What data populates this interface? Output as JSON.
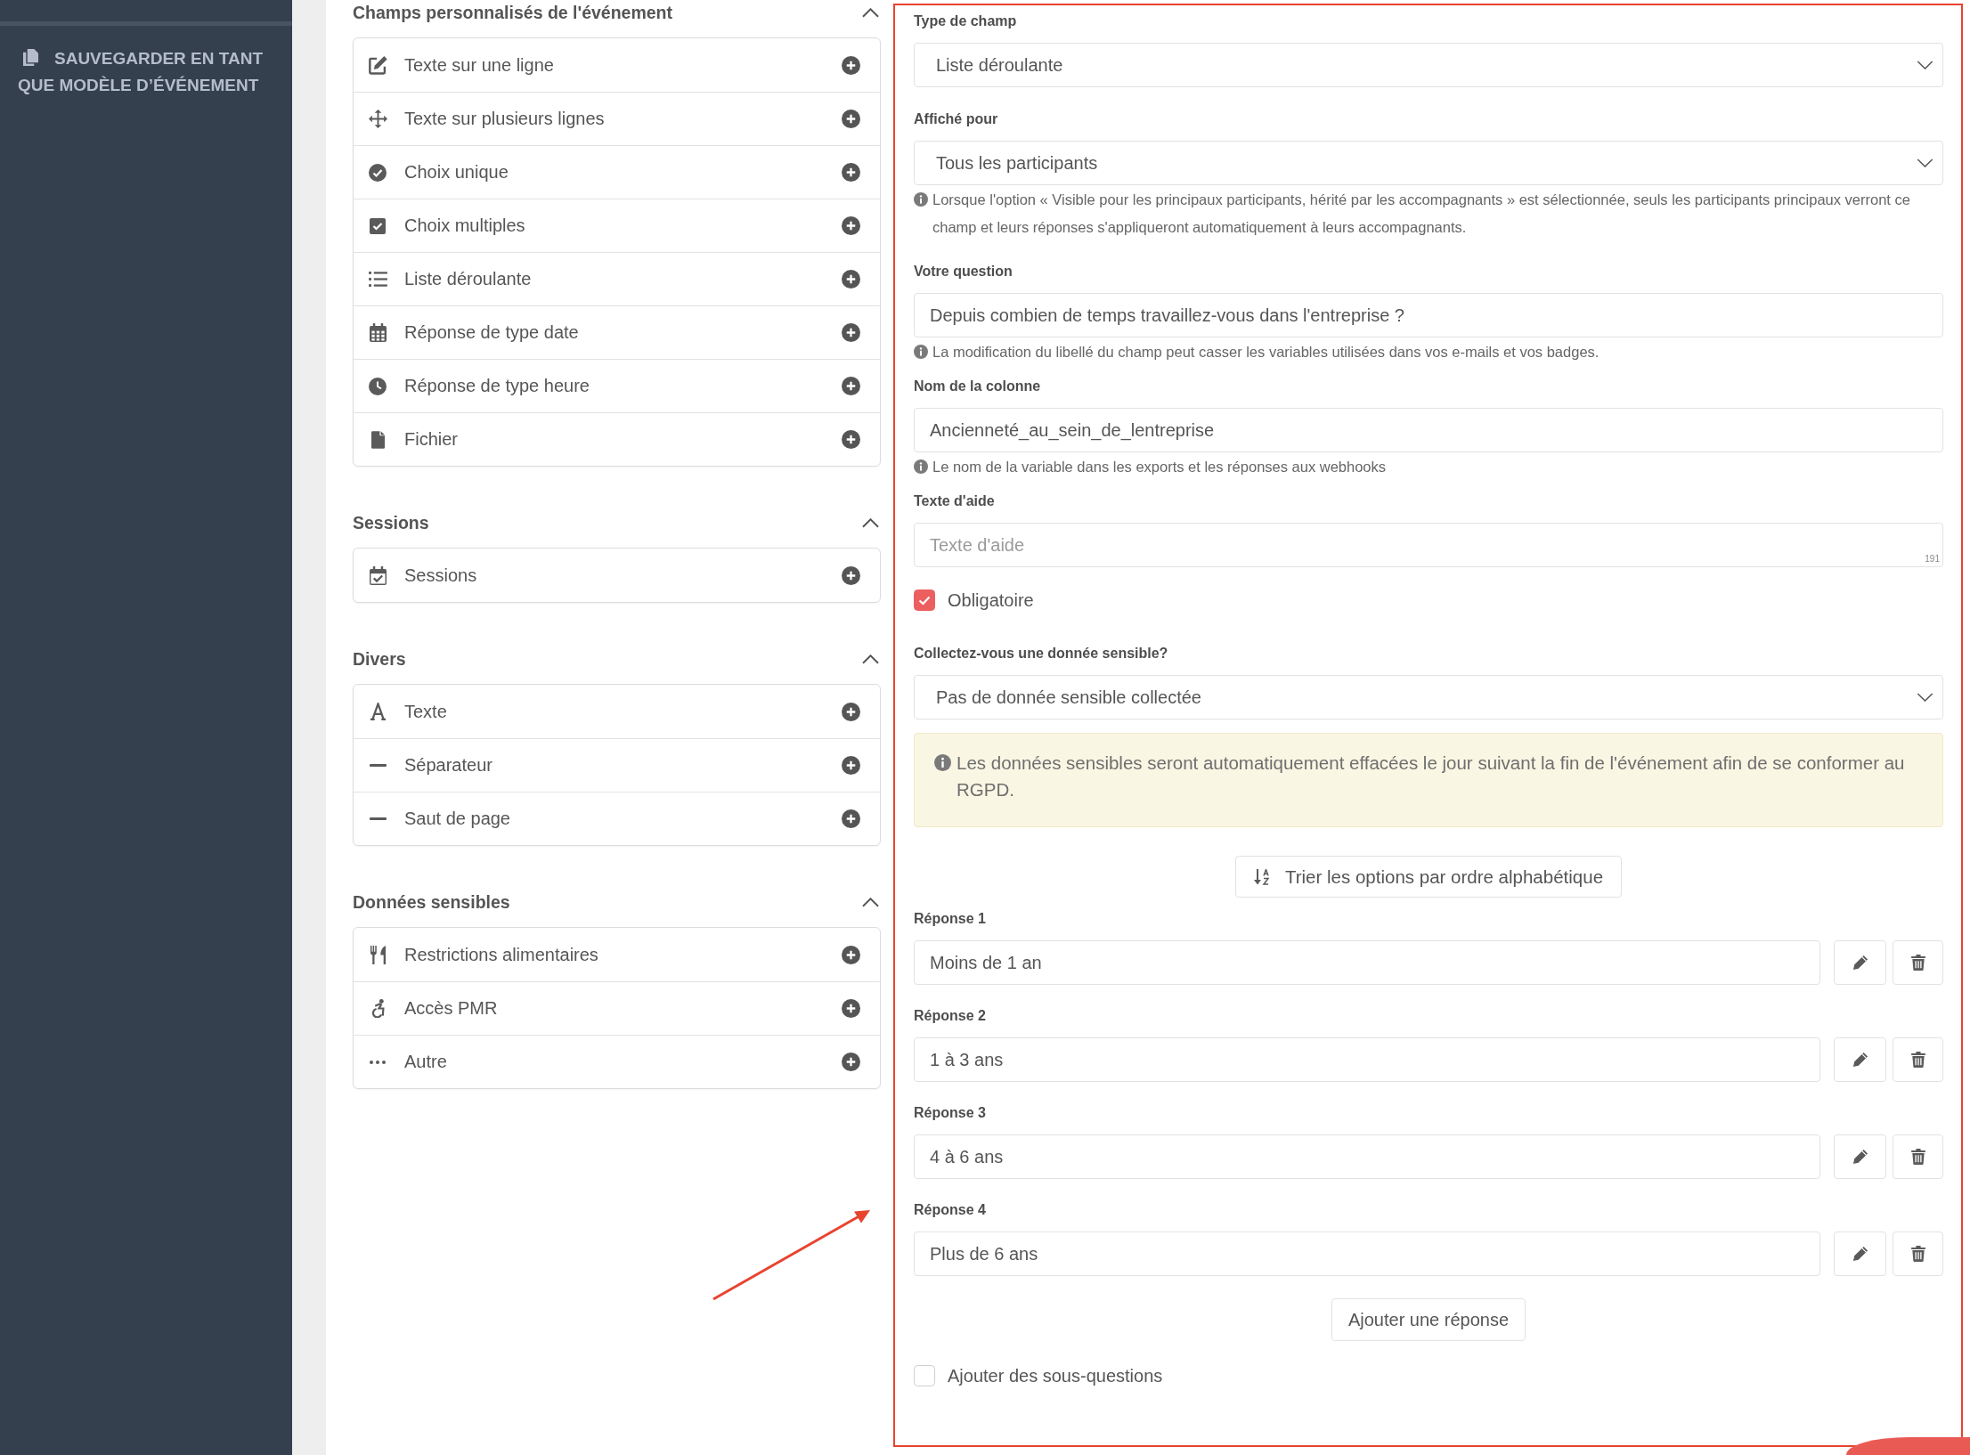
{
  "sidebar": {
    "save_template_button": "SAUVEGARDER EN TANT QUE MODÈLE D’ÉVÉNEMENT"
  },
  "palette": {
    "sections": [
      {
        "title": "Champs personnalisés de l'événement",
        "expanded": true,
        "items": [
          {
            "kind": "textline",
            "label": "Texte sur une ligne"
          },
          {
            "kind": "textarea",
            "label": "Texte sur plusieurs lignes"
          },
          {
            "kind": "radio",
            "label": "Choix unique"
          },
          {
            "kind": "checkbox",
            "label": "Choix multiples"
          },
          {
            "kind": "select",
            "label": "Liste déroulante"
          },
          {
            "kind": "date",
            "label": "Réponse de type date"
          },
          {
            "kind": "time",
            "label": "Réponse de type heure"
          },
          {
            "kind": "file",
            "label": "Fichier"
          }
        ]
      },
      {
        "title": "Sessions",
        "expanded": true,
        "items": [
          {
            "kind": "sessions",
            "label": "Sessions"
          }
        ]
      },
      {
        "title": "Divers",
        "expanded": true,
        "items": [
          {
            "kind": "text",
            "label": "Texte"
          },
          {
            "kind": "separator",
            "label": "Séparateur"
          },
          {
            "kind": "pagebreak",
            "label": "Saut de page"
          }
        ]
      },
      {
        "title": "Données sensibles",
        "expanded": true,
        "items": [
          {
            "kind": "diet",
            "label": "Restrictions alimentaires"
          },
          {
            "kind": "accessibility",
            "label": "Accès PMR"
          },
          {
            "kind": "other",
            "label": "Autre"
          }
        ]
      }
    ]
  },
  "editor": {
    "fields": [
      {
        "kind": "select",
        "label": "Type de champ",
        "value": "Liste déroulante"
      },
      {
        "kind": "select",
        "label": "Affiché pour",
        "value": "Tous les participants",
        "hint": "Lorsque l'option « Visible pour les principaux participants, hérité par les accompagnants » est sélectionnée, seuls les participants principaux verront ce champ et leurs réponses s'appliqueront automatiquement à leurs accompagnants."
      },
      {
        "kind": "input",
        "label": "Votre question",
        "value": "Depuis combien de temps travaillez-vous dans l'entreprise ?",
        "hint": "La modification du libellé du champ peut casser les variables utilisées dans vos e-mails et vos badges."
      },
      {
        "kind": "input",
        "label": "Nom de la colonne",
        "value": "Ancienneté_au_sein_de_lentreprise",
        "hint": "Le nom de la variable dans les exports et les réponses aux webhooks"
      },
      {
        "kind": "textarea",
        "label": "Texte d'aide",
        "placeholder": "Texte d'aide",
        "counter": "191"
      },
      {
        "kind": "checkbox",
        "label": "Obligatoire",
        "checked": true
      },
      {
        "kind": "select",
        "label": "Collectez-vous une donnée sensible?",
        "value": "Pas de donnée sensible collectée",
        "notice": "Les données sensibles seront automatiquement effacées le jour suivant la fin de l'événement afin de se conformer au RGPD."
      }
    ],
    "sort_button": "Trier les options par ordre alphabétique",
    "answers": [
      {
        "label": "Réponse 1",
        "value": "Moins de 1 an"
      },
      {
        "label": "Réponse 2",
        "value": "1 à 3 ans"
      },
      {
        "label": "Réponse 3",
        "value": "4 à 6 ans"
      },
      {
        "label": "Réponse 4",
        "value": "Plus de 6 ans"
      }
    ],
    "add_answer_button": "Ajouter une réponse",
    "sub_questions": {
      "label": "Ajouter des sous-questions",
      "checked": false
    }
  }
}
